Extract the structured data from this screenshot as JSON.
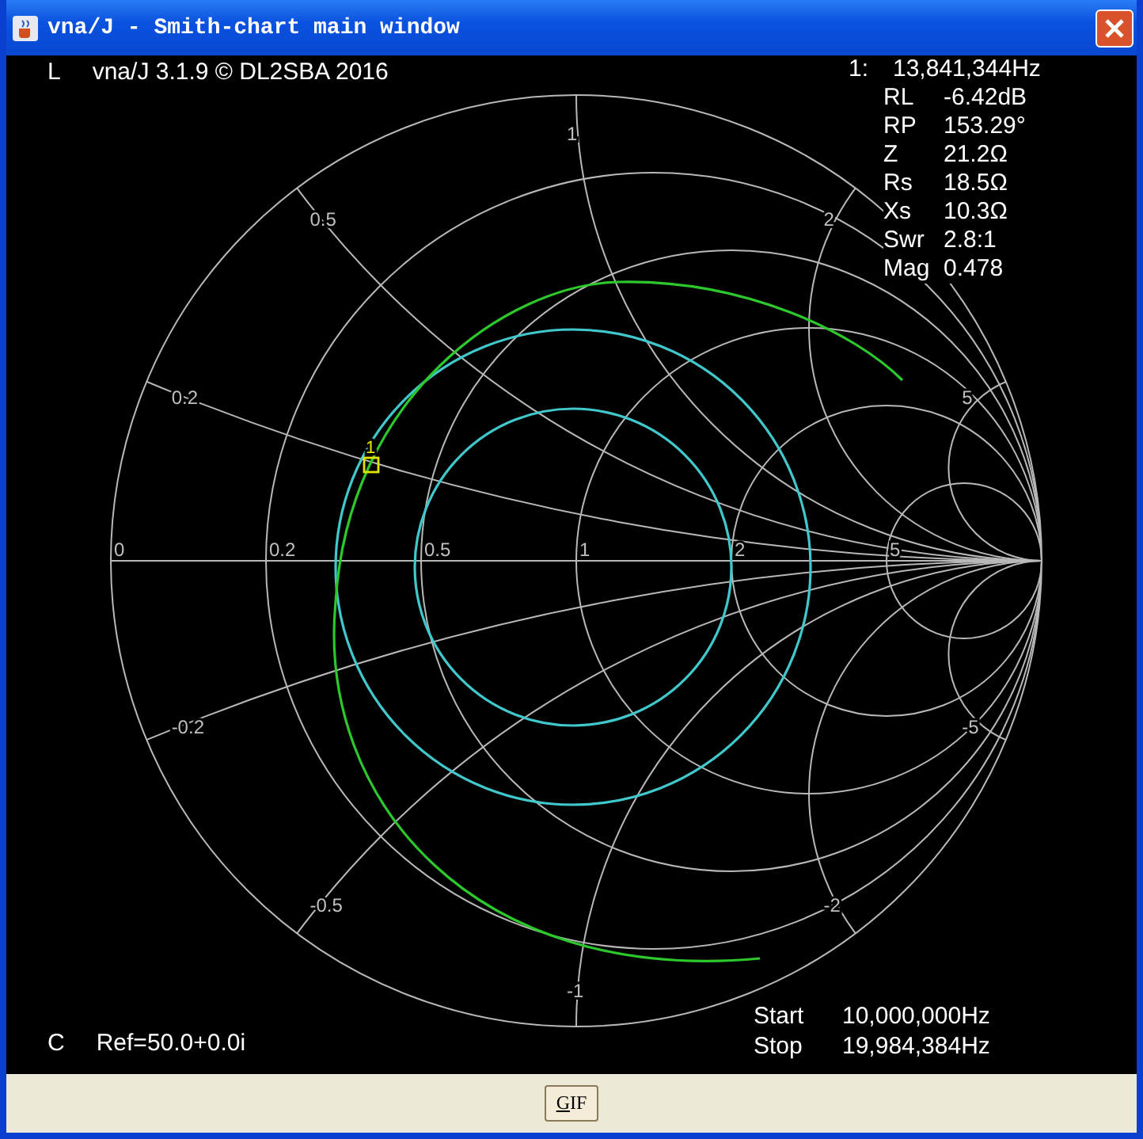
{
  "window": {
    "title": "vna/J - Smith-chart main window"
  },
  "header": {
    "mode": "L",
    "version": "vna/J 3.1.9  © DL2SBA 2016"
  },
  "readout": {
    "marker": "1:",
    "frequency": "13,841,344Hz",
    "rows": [
      {
        "name": "RL",
        "value": "-6.42dB"
      },
      {
        "name": "RP",
        "value": "153.29°"
      },
      {
        "name": "Z",
        "value": "21.2Ω"
      },
      {
        "name": "Rs",
        "value": "18.5Ω"
      },
      {
        "name": "Xs",
        "value": "10.3Ω"
      },
      {
        "name": "Swr",
        "value": "2.8:1"
      },
      {
        "name": "Mag",
        "value": "0.478"
      }
    ]
  },
  "chart": {
    "resistance_labels": [
      "0",
      "0.2",
      "0.5",
      "1",
      "2",
      "5"
    ],
    "reactance_labels": [
      "0.2",
      "0.5",
      "1",
      "2",
      "5",
      "-0.2",
      "-0.5",
      "-1",
      "-2",
      "-5"
    ],
    "marker_label": "1"
  },
  "footer": {
    "mode": "C",
    "reference": "Ref=50.0+0.0i",
    "start_label": "Start",
    "start_value": "10,000,000Hz",
    "stop_label": "Stop",
    "stop_value": "19,984,384Hz"
  },
  "buttons": [
    "GIF"
  ]
}
